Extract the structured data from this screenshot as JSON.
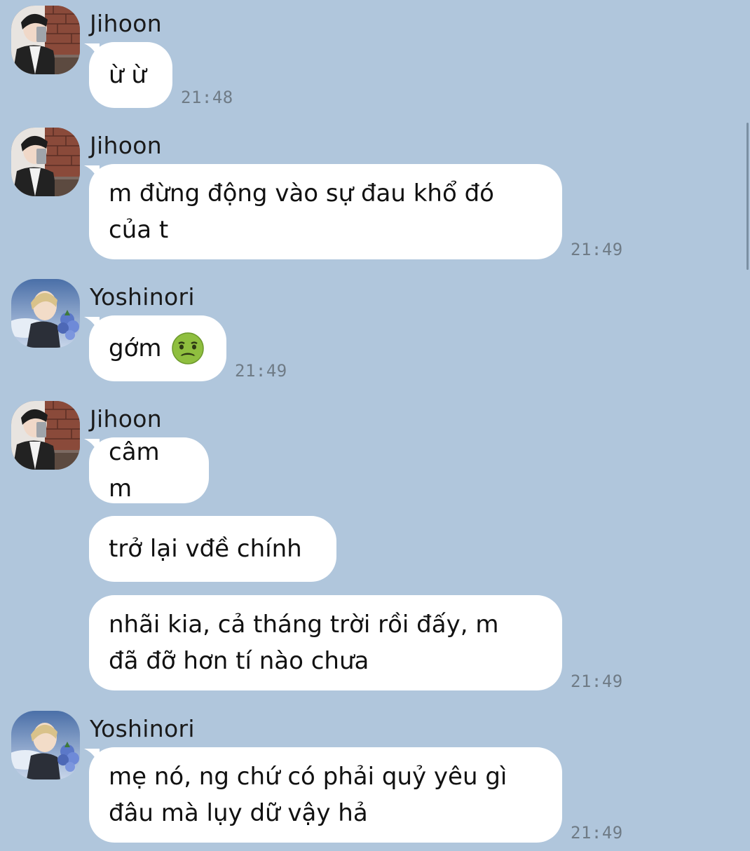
{
  "messages": [
    {
      "sender": "Jihoon",
      "text": "ừ ừ",
      "time": "21:48"
    },
    {
      "sender": "Jihoon",
      "text_line1": "m đừng động vào sự đau khổ đó",
      "text_line2": "của t",
      "time": "21:49"
    },
    {
      "sender": "Yoshinori",
      "text": "gớm",
      "emoji": "nauseated-face",
      "time": "21:49"
    },
    {
      "sender": "Jihoon",
      "text": "câm m"
    },
    {
      "text": "trở lại vđề chính"
    },
    {
      "text_line1": "nhãi kia, cả tháng trời rồi đấy, m",
      "text_line2": "đã đỡ hơn tí nào chưa",
      "time": "21:49"
    },
    {
      "sender": "Yoshinori",
      "text_line1": "mẹ nó, ng chứ có phải quỷ yêu gì",
      "text_line2": "đâu mà lụy dữ vậy hả",
      "time": "21:49"
    }
  ],
  "colors": {
    "background": "#b0c6dc",
    "bubble": "#ffffff",
    "timestamp": "#6f7b86"
  }
}
